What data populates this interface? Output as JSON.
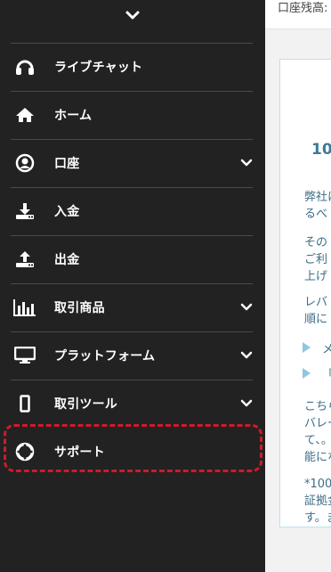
{
  "sidebar": {
    "items": [
      {
        "label": "ライブチャット",
        "icon": "headset-icon",
        "expandable": false
      },
      {
        "label": "ホーム",
        "icon": "home-icon",
        "expandable": false
      },
      {
        "label": "口座",
        "icon": "account-circle-icon",
        "expandable": true
      },
      {
        "label": "入金",
        "icon": "download-tray-icon",
        "expandable": false
      },
      {
        "label": "出金",
        "icon": "upload-tray-icon",
        "expandable": false
      },
      {
        "label": "取引商品",
        "icon": "bar-chart-icon",
        "expandable": true
      },
      {
        "label": "プラットフォーム",
        "icon": "monitor-icon",
        "expandable": true
      },
      {
        "label": "取引ツール",
        "icon": "phone-icon",
        "expandable": true
      },
      {
        "label": "サポート",
        "icon": "lifebuoy-icon",
        "expandable": false
      }
    ],
    "highlighted_item": "サポート"
  },
  "main": {
    "header_text": "口座残高:",
    "card": {
      "heading": "10",
      "paragraphs": [
        "弊社に\nるべ",
        "その\nご利\n上げ",
        "レバ\n順に"
      ],
      "bullets": [
        "メ",
        "「"
      ],
      "paragraph2": "こちら\nバレー\nて、。\n能にな",
      "footnote": "*100\n証拠金\nす。ま"
    }
  },
  "colors": {
    "sidebar_bg": "#222222",
    "highlight": "#cc1c27",
    "content_text": "#3e6d87"
  }
}
